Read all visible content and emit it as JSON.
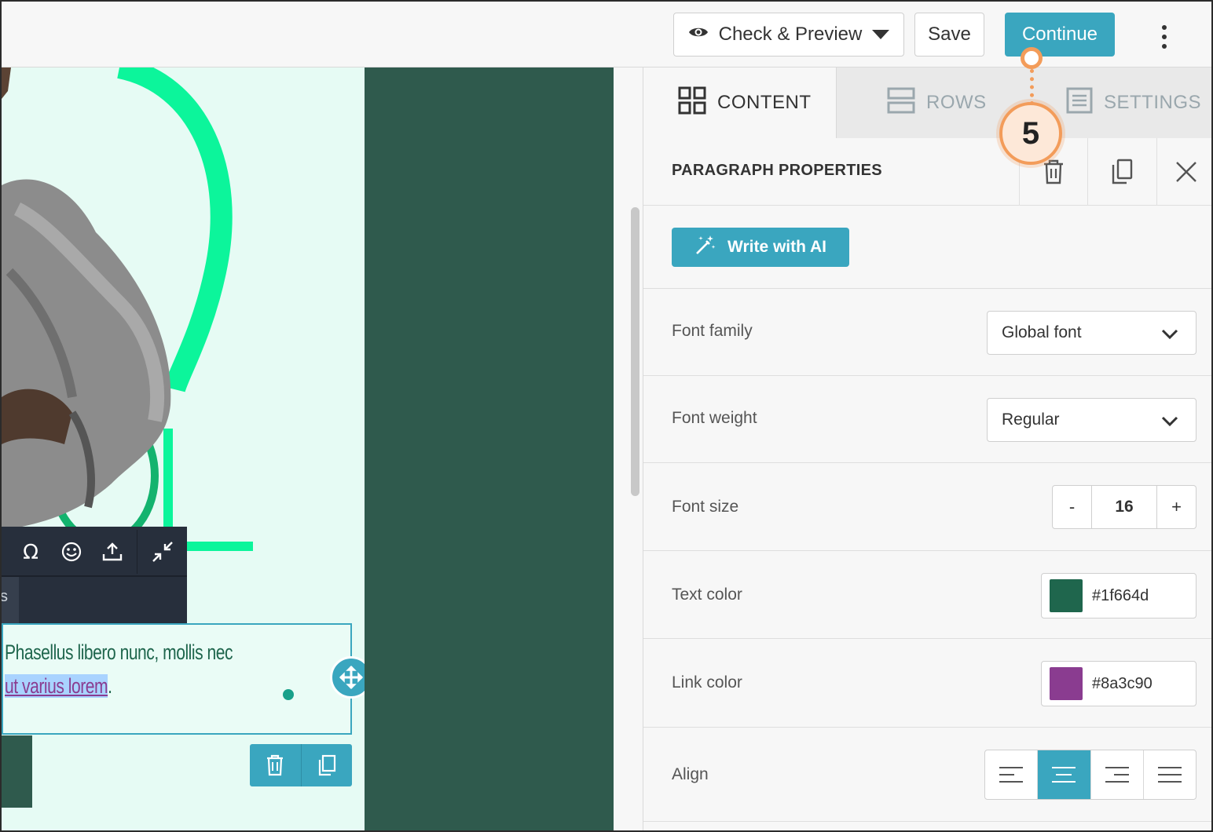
{
  "topbar": {
    "preview_label": "Check & Preview",
    "save_label": "Save",
    "continue_label": "Continue"
  },
  "tabs": [
    {
      "label": "CONTENT",
      "icon": "grid-icon",
      "active": true
    },
    {
      "label": "ROWS",
      "icon": "rows-icon",
      "active": false
    },
    {
      "label": "SETTINGS",
      "icon": "settings-list-icon",
      "active": false
    }
  ],
  "properties": {
    "title": "PARAGRAPH PROPERTIES",
    "ai_button_label": "Write with AI",
    "font_family": {
      "label": "Font family",
      "value": "Global font"
    },
    "font_weight": {
      "label": "Font weight",
      "value": "Regular"
    },
    "font_size": {
      "label": "Font size",
      "minus": "-",
      "value": "16",
      "plus": "+"
    },
    "text_color": {
      "label": "Text color",
      "value": "#1f664d"
    },
    "link_color": {
      "label": "Link color",
      "value": "#8a3c90"
    },
    "align": {
      "label": "Align",
      "selected": "center"
    }
  },
  "canvas": {
    "paragraph_line1": "Phasellus libero nunc, mollis nec",
    "paragraph_link": "ut varius lorem",
    "paragraph_end": ".",
    "toolbar_peek_char": "s"
  },
  "callout": {
    "number": "5"
  },
  "colors": {
    "accent": "#3aa6bf",
    "callout": "#f39c5a",
    "dark_green": "#2f5a4d",
    "mint": "#e6fbf4",
    "bright_green": "#0cf59b"
  }
}
